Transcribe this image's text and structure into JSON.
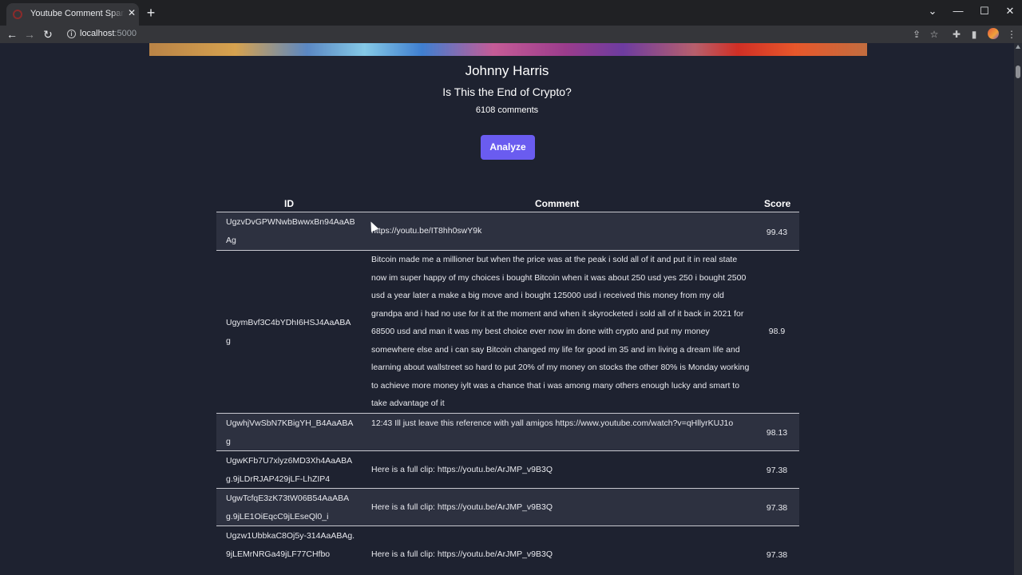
{
  "browser": {
    "tab_title": "Youtube Comment Spam Report",
    "tab_close": "✕",
    "new_tab": "+",
    "url_host": "localhost",
    "url_port": ":5000"
  },
  "page": {
    "channel_name": "Johnny Harris",
    "video_title": "Is This the End of Crypto?",
    "comment_count": "6108 comments",
    "analyze_label": "Analyze"
  },
  "table": {
    "headers": {
      "id": "ID",
      "comment": "Comment",
      "score": "Score"
    },
    "rows": [
      {
        "id": "UgzvDvGPWNwbBwwxBn94AaABAg",
        "comment": "https://youtu.be/IT8hh0swY9k",
        "score": "99.43"
      },
      {
        "id": "UgymBvf3C4bYDhI6HSJ4AaABAg",
        "comment": "Bitcoin made me a millioner but when the price was at the peak i sold all of it and put it in real state now im super happy of my choices i bought Bitcoin when it was about 250 usd yes 250 i bought 2500 usd a year later a make a big move and i bought 125000 usd i received this money from my old grandpa and i had no use for it at the moment and when it skyrocketed i sold all of it back in 2021 for 68500 usd and man it was my best choice ever now im done with crypto and put my money somewhere else and i can say Bitcoin changed my life for good im 35 and im living a dream life and learning about wallstreet so hard to put 20% of my money on stocks the other 80% is Monday working to achieve more money iylt was a chance that i was among many others enough lucky and smart to take advantage of it",
        "score": "98.9"
      },
      {
        "id": "UgwhjVwSbN7KBigYH_B4AaABAg",
        "comment": "12:43 Ill just leave this reference with yall amigos https://www.youtube.com/watch?v=qHllyrKUJ1o",
        "score": "98.13"
      },
      {
        "id": "UgwKFb7U7xlyz6MD3Xh4AaABAg.9jLDrRJAP429jLF-LhZIP4",
        "comment": "Here is a full clip: https://youtu.be/ArJMP_v9B3Q",
        "score": "97.38"
      },
      {
        "id": "UgwTcfqE3zK73tW06B54AaABAg.9jLE1OiEqcC9jLEseQl0_i",
        "comment": "Here is a full clip: https://youtu.be/ArJMP_v9B3Q",
        "score": "97.38"
      },
      {
        "id": "Ugzw1UbbkaC8Oj5y-314AaABAg.9jLEMrNRGa49jLF77CHfbo",
        "comment": "Here is a full clip: https://youtu.be/ArJMP_v9B3Q",
        "score": "97.38"
      }
    ]
  }
}
